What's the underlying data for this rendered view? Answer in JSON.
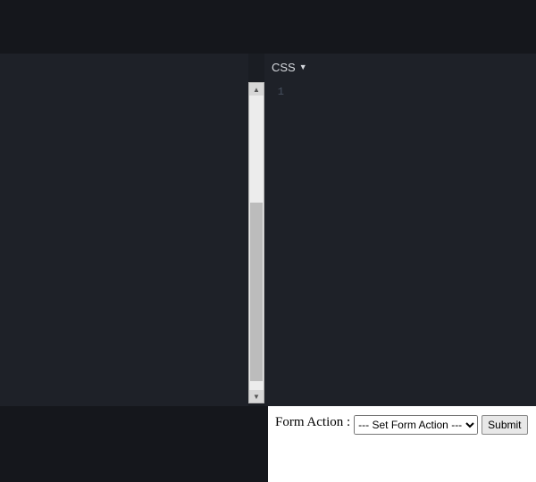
{
  "tabs": {
    "css_label": "CSS"
  },
  "editor": {
    "line_number": "1",
    "content": ""
  },
  "form": {
    "label": "Form Action :",
    "select_value": "--- Set Form Action ---",
    "submit_label": "Submit"
  }
}
